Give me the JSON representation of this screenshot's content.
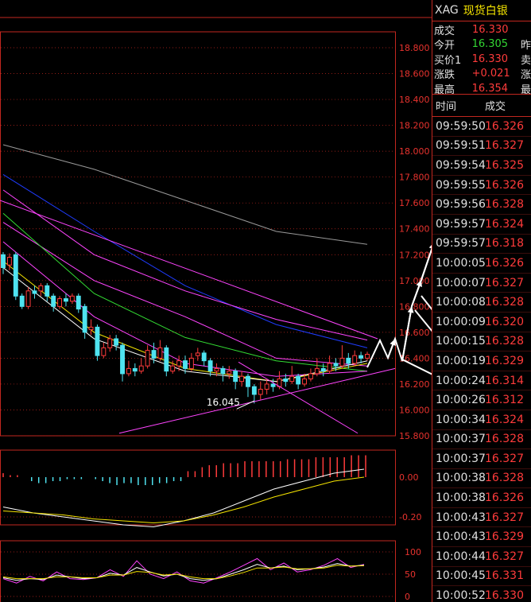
{
  "header": {
    "code": "XAG",
    "name": "现货白银"
  },
  "summary": [
    {
      "label": "成交",
      "value": "16.330",
      "color": "up",
      "extra": ""
    },
    {
      "label": "今开",
      "value": "16.305",
      "color": "down",
      "extra": "昨"
    },
    {
      "label": "买价1",
      "value": "16.330",
      "color": "up",
      "extra": "卖"
    },
    {
      "label": "涨跌",
      "value": "+0.021",
      "color": "up",
      "extra": "涨"
    },
    {
      "label": "最高",
      "value": "16.354",
      "color": "up",
      "extra": "最"
    }
  ],
  "ticks_header": {
    "time": "时间",
    "price": "成交"
  },
  "ticks": [
    {
      "time": "09:59:50",
      "price": "16.326"
    },
    {
      "time": "09:59:51",
      "price": "16.327"
    },
    {
      "time": "09:59:54",
      "price": "16.325"
    },
    {
      "time": "09:59:55",
      "price": "16.326"
    },
    {
      "time": "09:59:56",
      "price": "16.328"
    },
    {
      "time": "09:59:57",
      "price": "16.324"
    },
    {
      "time": "09:59:57",
      "price": "16.318"
    },
    {
      "time": "10:00:05",
      "price": "16.326"
    },
    {
      "time": "10:00:07",
      "price": "16.327"
    },
    {
      "time": "10:00:08",
      "price": "16.328"
    },
    {
      "time": "10:00:09",
      "price": "16.320"
    },
    {
      "time": "10:00:15",
      "price": "16.328"
    },
    {
      "time": "10:00:19",
      "price": "16.329"
    },
    {
      "time": "10:00:24",
      "price": "16.314"
    },
    {
      "time": "10:00:26",
      "price": "16.312"
    },
    {
      "time": "10:00:34",
      "price": "16.324"
    },
    {
      "time": "10:00:37",
      "price": "16.328"
    },
    {
      "time": "10:00:37",
      "price": "16.327"
    },
    {
      "time": "10:00:38",
      "price": "16.328"
    },
    {
      "time": "10:00:38",
      "price": "16.326"
    },
    {
      "time": "10:00:43",
      "price": "16.327"
    },
    {
      "time": "10:00:43",
      "price": "16.329"
    },
    {
      "time": "10:00:44",
      "price": "16.327"
    },
    {
      "time": "10:00:45",
      "price": "16.331"
    },
    {
      "time": "10:00:52",
      "price": "16.330"
    }
  ],
  "colors": {
    "up": "#ff3b3b",
    "down": "#33d633",
    "frame": "#c2271f",
    "bull_candle": "#ff3b3b",
    "bear_candle": "#4fe3f0"
  },
  "chart_data": {
    "type": "candlestick",
    "price_axis": {
      "ticks": [
        "18.800",
        "18.600",
        "18.400",
        "18.200",
        "18.000",
        "17.800",
        "17.600",
        "17.400",
        "17.200",
        "17.000",
        "16.800",
        "16.600",
        "16.400",
        "16.200",
        "16.000",
        "15.800"
      ],
      "range": [
        15.8,
        18.8
      ]
    },
    "annotation_low": "16.045",
    "macd_axis": {
      "ticks": [
        "0.00",
        "-0.20"
      ]
    },
    "kdj_axis": {
      "ticks": [
        "100",
        "50",
        "0"
      ]
    },
    "candles": [
      {
        "o": 17.2,
        "c": 17.1,
        "h": 17.22,
        "l": 17.05
      },
      {
        "o": 17.12,
        "c": 17.18,
        "h": 17.21,
        "l": 17.08
      },
      {
        "o": 17.2,
        "c": 16.88,
        "h": 17.22,
        "l": 16.85
      },
      {
        "o": 16.88,
        "c": 16.8,
        "h": 16.9,
        "l": 16.78
      },
      {
        "o": 16.8,
        "c": 16.92,
        "h": 16.95,
        "l": 16.78
      },
      {
        "o": 16.92,
        "c": 16.9,
        "h": 16.96,
        "l": 16.86
      },
      {
        "o": 16.92,
        "c": 16.96,
        "h": 16.98,
        "l": 16.88
      },
      {
        "o": 16.96,
        "c": 16.88,
        "h": 16.98,
        "l": 16.84
      },
      {
        "o": 16.88,
        "c": 16.8,
        "h": 16.9,
        "l": 16.76
      },
      {
        "o": 16.8,
        "c": 16.86,
        "h": 16.88,
        "l": 16.78
      },
      {
        "o": 16.86,
        "c": 16.84,
        "h": 16.9,
        "l": 16.8
      },
      {
        "o": 16.84,
        "c": 16.88,
        "h": 16.9,
        "l": 16.82
      },
      {
        "o": 16.88,
        "c": 16.78,
        "h": 16.9,
        "l": 16.75
      },
      {
        "o": 16.8,
        "c": 16.6,
        "h": 16.82,
        "l": 16.55
      },
      {
        "o": 16.62,
        "c": 16.64,
        "h": 16.7,
        "l": 16.58
      },
      {
        "o": 16.64,
        "c": 16.42,
        "h": 16.66,
        "l": 16.38
      },
      {
        "o": 16.42,
        "c": 16.48,
        "h": 16.52,
        "l": 16.4
      },
      {
        "o": 16.48,
        "c": 16.55,
        "h": 16.58,
        "l": 16.45
      },
      {
        "o": 16.55,
        "c": 16.5,
        "h": 16.58,
        "l": 16.46
      },
      {
        "o": 16.5,
        "c": 16.28,
        "h": 16.52,
        "l": 16.22
      },
      {
        "o": 16.28,
        "c": 16.32,
        "h": 16.38,
        "l": 16.26
      },
      {
        "o": 16.32,
        "c": 16.3,
        "h": 16.36,
        "l": 16.26
      },
      {
        "o": 16.3,
        "c": 16.34,
        "h": 16.4,
        "l": 16.28
      },
      {
        "o": 16.34,
        "c": 16.46,
        "h": 16.5,
        "l": 16.32
      },
      {
        "o": 16.46,
        "c": 16.4,
        "h": 16.52,
        "l": 16.36
      },
      {
        "o": 16.4,
        "c": 16.48,
        "h": 16.54,
        "l": 16.38
      },
      {
        "o": 16.48,
        "c": 16.3,
        "h": 16.5,
        "l": 16.26
      },
      {
        "o": 16.3,
        "c": 16.34,
        "h": 16.38,
        "l": 16.28
      },
      {
        "o": 16.34,
        "c": 16.38,
        "h": 16.42,
        "l": 16.3
      },
      {
        "o": 16.38,
        "c": 16.32,
        "h": 16.42,
        "l": 16.28
      },
      {
        "o": 16.32,
        "c": 16.4,
        "h": 16.44,
        "l": 16.3
      },
      {
        "o": 16.42,
        "c": 16.44,
        "h": 16.48,
        "l": 16.38
      },
      {
        "o": 16.44,
        "c": 16.38,
        "h": 16.46,
        "l": 16.34
      },
      {
        "o": 16.38,
        "c": 16.3,
        "h": 16.4,
        "l": 16.26
      },
      {
        "o": 16.3,
        "c": 16.32,
        "h": 16.36,
        "l": 16.26
      },
      {
        "o": 16.32,
        "c": 16.28,
        "h": 16.34,
        "l": 16.22
      },
      {
        "o": 16.28,
        "c": 16.3,
        "h": 16.34,
        "l": 16.24
      },
      {
        "o": 16.3,
        "c": 16.22,
        "h": 16.32,
        "l": 16.16
      },
      {
        "o": 16.22,
        "c": 16.26,
        "h": 16.3,
        "l": 16.18
      },
      {
        "o": 16.26,
        "c": 16.18,
        "h": 16.28,
        "l": 16.1
      },
      {
        "o": 16.18,
        "c": 16.12,
        "h": 16.2,
        "l": 16.05
      },
      {
        "o": 16.12,
        "c": 16.16,
        "h": 16.22,
        "l": 16.08
      },
      {
        "o": 16.16,
        "c": 16.2,
        "h": 16.24,
        "l": 16.12
      },
      {
        "o": 16.2,
        "c": 16.18,
        "h": 16.24,
        "l": 16.14
      },
      {
        "o": 16.18,
        "c": 16.24,
        "h": 16.3,
        "l": 16.16
      },
      {
        "o": 16.24,
        "c": 16.22,
        "h": 16.28,
        "l": 16.18
      },
      {
        "o": 16.22,
        "c": 16.26,
        "h": 16.34,
        "l": 16.2
      },
      {
        "o": 16.26,
        "c": 16.2,
        "h": 16.28,
        "l": 16.16
      },
      {
        "o": 16.2,
        "c": 16.24,
        "h": 16.28,
        "l": 16.18
      },
      {
        "o": 16.24,
        "c": 16.28,
        "h": 16.32,
        "l": 16.22
      },
      {
        "o": 16.28,
        "c": 16.32,
        "h": 16.4,
        "l": 16.26
      },
      {
        "o": 16.32,
        "c": 16.3,
        "h": 16.36,
        "l": 16.26
      },
      {
        "o": 16.3,
        "c": 16.36,
        "h": 16.42,
        "l": 16.28
      },
      {
        "o": 16.36,
        "c": 16.34,
        "h": 16.4,
        "l": 16.3
      },
      {
        "o": 16.34,
        "c": 16.4,
        "h": 16.5,
        "l": 16.32
      },
      {
        "o": 16.4,
        "c": 16.36,
        "h": 16.44,
        "l": 16.32
      },
      {
        "o": 16.36,
        "c": 16.42,
        "h": 16.46,
        "l": 16.34
      },
      {
        "o": 16.42,
        "c": 16.4,
        "h": 16.45,
        "l": 16.36
      },
      {
        "o": 16.4,
        "c": 16.43,
        "h": 16.45,
        "l": 16.38
      }
    ],
    "ma_lines": [
      {
        "color": "#9a9a9a",
        "values": [
          18.05,
          17.86,
          17.62,
          17.38,
          17.28
        ]
      },
      {
        "color": "#1f3cff",
        "values": [
          17.82,
          17.38,
          16.96,
          16.66,
          16.48
        ]
      },
      {
        "color": "#ff44ff",
        "values": [
          17.7,
          17.2,
          16.92,
          16.7,
          16.54
        ]
      },
      {
        "color": "#ff44ff",
        "values": [
          17.45,
          17.0,
          16.72,
          16.4,
          16.34
        ]
      },
      {
        "color": "#33dd33",
        "values": [
          17.52,
          16.9,
          16.56,
          16.38,
          16.3
        ]
      },
      {
        "color": "#ff44ff",
        "values": [
          17.3,
          16.72,
          16.36,
          16.26,
          16.3
        ]
      },
      {
        "color": "#f5e400",
        "values": [
          17.15,
          16.6,
          16.32,
          16.22,
          16.36
        ]
      },
      {
        "color": "#ffffff",
        "values": [
          17.1,
          16.55,
          16.3,
          16.22,
          16.38
        ]
      }
    ],
    "macd_hist": [
      0.02,
      0.01,
      0.01,
      0.0,
      -0.02,
      -0.03,
      -0.03,
      -0.02,
      -0.02,
      -0.01,
      -0.01,
      -0.01,
      0.0,
      -0.01,
      -0.02,
      -0.03,
      -0.04,
      -0.03,
      -0.03,
      -0.04,
      -0.04,
      -0.04,
      -0.03,
      -0.03,
      -0.02,
      -0.02,
      0.03,
      0.03,
      0.05,
      0.06,
      0.06,
      0.07,
      0.07,
      0.07,
      0.08,
      0.08,
      0.08,
      0.08,
      0.08,
      0.08,
      0.09,
      0.09,
      0.09,
      0.09,
      0.1,
      0.1,
      0.1,
      0.1,
      0.1,
      0.11,
      0.11,
      0.11
    ],
    "macd_lines": [
      {
        "color": "#ffffff",
        "values": [
          -0.15,
          -0.18,
          -0.2,
          -0.22,
          -0.24,
          -0.25,
          -0.22,
          -0.18,
          -0.12,
          -0.06,
          -0.02,
          0.02,
          0.04
        ]
      },
      {
        "color": "#f5e400",
        "values": [
          -0.17,
          -0.18,
          -0.19,
          -0.21,
          -0.22,
          -0.23,
          -0.22,
          -0.19,
          -0.15,
          -0.1,
          -0.06,
          -0.02,
          0.0
        ]
      }
    ],
    "kdj_lines": [
      {
        "color": "#ff44ff",
        "values": [
          40,
          30,
          45,
          35,
          55,
          40,
          38,
          42,
          60,
          45,
          80,
          50,
          40,
          55,
          35,
          30,
          42,
          55,
          70,
          85,
          60,
          75,
          55,
          60,
          70,
          85,
          65,
          72
        ]
      },
      {
        "color": "#ffffff",
        "values": [
          42,
          36,
          40,
          38,
          48,
          44,
          40,
          42,
          52,
          48,
          65,
          55,
          46,
          50,
          40,
          36,
          40,
          50,
          60,
          72,
          64,
          68,
          60,
          62,
          66,
          74,
          68,
          70
        ]
      },
      {
        "color": "#f5e400",
        "values": [
          44,
          40,
          40,
          40,
          44,
          44,
          42,
          42,
          48,
          48,
          56,
          54,
          48,
          50,
          44,
          40,
          40,
          46,
          54,
          64,
          64,
          66,
          62,
          62,
          64,
          70,
          68,
          69
        ]
      }
    ]
  }
}
